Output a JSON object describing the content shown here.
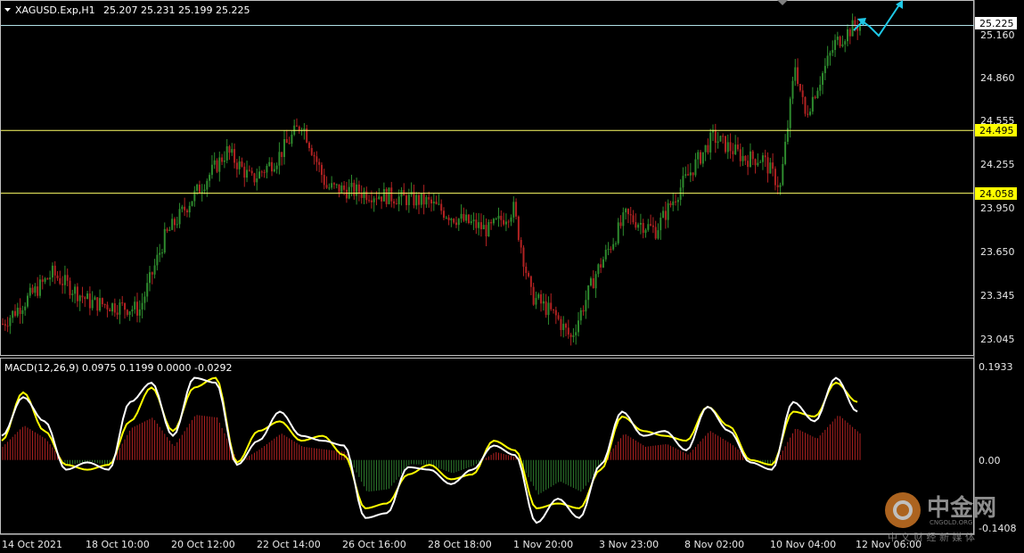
{
  "header": {
    "symbol": "XAGUSD.Exp,H1",
    "ohlc": "25.207 25.231 25.199 25.225"
  },
  "macd_header": {
    "label": "MACD(12,26,9) 0.0975 0.1199 0.0000 -0.0292"
  },
  "price_axis": {
    "ticks": [
      "25.160",
      "24.860",
      "24.555",
      "24.255",
      "23.950",
      "23.650",
      "23.345",
      "23.045"
    ],
    "current_price": "25.225",
    "levels": [
      "24.495",
      "24.058"
    ]
  },
  "macd_axis": {
    "ticks": [
      "0.1933",
      "0.00",
      "-0.1408"
    ]
  },
  "time_axis": {
    "ticks": [
      "14 Oct 2021",
      "18 Oct 10:00",
      "20 Oct 12:00",
      "22 Oct 14:00",
      "26 Oct 16:00",
      "28 Oct 18:00",
      "1 Nov 20:00",
      "3 Nov 23:00",
      "8 Nov 02:00",
      "10 Nov 04:00",
      "12 Nov 06:00"
    ]
  },
  "watermark": {
    "brand": "中金网",
    "site": "CNGOLD.ORG",
    "tagline": "中 文 财 经 新 媒 体"
  },
  "colors": {
    "bull": "#2e8b2e",
    "bear": "#b22222",
    "level_line": "#ffff66",
    "current_line": "#b0e0e6",
    "arrow": "#1ec8e6",
    "macd_line": "#ffffff",
    "signal_line": "#ffff00",
    "hist_pos": "#b22222",
    "hist_neg": "#2e7d2e"
  },
  "chart_data": [
    {
      "type": "candlestick",
      "title": "XAGUSD.Exp,H1",
      "ylim": [
        22.95,
        25.3
      ],
      "key_prices": [
        {
          "time_idx": 0,
          "price": 23.15
        },
        {
          "time_idx": 20,
          "price": 23.5
        },
        {
          "time_idx": 35,
          "price": 23.3
        },
        {
          "time_idx": 55,
          "price": 23.25
        },
        {
          "time_idx": 65,
          "price": 23.75
        },
        {
          "time_idx": 75,
          "price": 24.0
        },
        {
          "time_idx": 90,
          "price": 24.35
        },
        {
          "time_idx": 100,
          "price": 24.15
        },
        {
          "time_idx": 110,
          "price": 24.3
        },
        {
          "time_idx": 120,
          "price": 24.55
        },
        {
          "time_idx": 130,
          "price": 24.1
        },
        {
          "time_idx": 150,
          "price": 24.05
        },
        {
          "time_idx": 170,
          "price": 24.0
        },
        {
          "time_idx": 180,
          "price": 23.9
        },
        {
          "time_idx": 195,
          "price": 23.8
        },
        {
          "time_idx": 205,
          "price": 23.95
        },
        {
          "time_idx": 212,
          "price": 23.35
        },
        {
          "time_idx": 222,
          "price": 23.2
        },
        {
          "time_idx": 228,
          "price": 23.05
        },
        {
          "time_idx": 238,
          "price": 23.5
        },
        {
          "time_idx": 250,
          "price": 23.9
        },
        {
          "time_idx": 262,
          "price": 23.8
        },
        {
          "time_idx": 272,
          "price": 24.1
        },
        {
          "time_idx": 285,
          "price": 24.45
        },
        {
          "time_idx": 298,
          "price": 24.3
        },
        {
          "time_idx": 305,
          "price": 24.3
        },
        {
          "time_idx": 312,
          "price": 24.1
        },
        {
          "time_idx": 318,
          "price": 24.95
        },
        {
          "time_idx": 322,
          "price": 24.6
        },
        {
          "time_idx": 328,
          "price": 24.85
        },
        {
          "time_idx": 334,
          "price": 25.1
        },
        {
          "time_idx": 342,
          "price": 25.225
        }
      ],
      "levels": [
        24.495,
        24.058
      ],
      "current_price": 25.225
    },
    {
      "type": "line",
      "title": "MACD(12,26,9)",
      "ylim": [
        -0.1408,
        0.1933
      ],
      "series": [
        {
          "name": "MACD",
          "values": [
            0.05,
            0.13,
            0.08,
            -0.02,
            -0.005,
            -0.02,
            0.12,
            0.16,
            0.05,
            0.17,
            0.16,
            -0.01,
            0.04,
            0.1,
            0.05,
            0.04,
            0.03,
            -0.12,
            -0.11,
            -0.015,
            -0.02,
            -0.05,
            -0.02,
            0.03,
            0.01,
            -0.13,
            -0.08,
            -0.12,
            -0.01,
            0.1,
            0.05,
            0.06,
            0.02,
            0.11,
            0.06,
            -0.005,
            -0.02,
            0.12,
            0.08,
            0.17,
            0.1
          ]
        },
        {
          "name": "Signal",
          "values": [
            0.04,
            0.14,
            0.06,
            -0.01,
            -0.02,
            -0.01,
            0.08,
            0.15,
            0.06,
            0.15,
            0.17,
            -0.005,
            0.06,
            0.08,
            0.04,
            0.05,
            0.01,
            -0.1,
            -0.09,
            -0.03,
            -0.01,
            -0.04,
            -0.03,
            0.04,
            0.02,
            -0.1,
            -0.09,
            -0.1,
            -0.02,
            0.09,
            0.06,
            0.05,
            0.04,
            0.11,
            0.07,
            0.0,
            -0.01,
            0.1,
            0.09,
            0.16,
            0.12
          ]
        }
      ]
    }
  ]
}
